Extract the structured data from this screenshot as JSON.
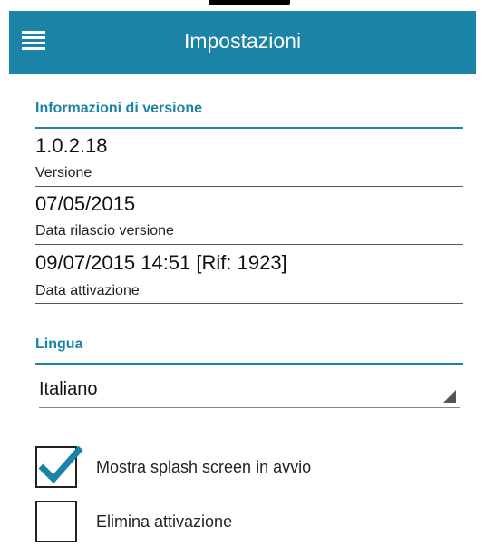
{
  "header": {
    "title": "Impostazioni",
    "menu_icon": "hamburger-menu-icon",
    "color": "#1b84a6"
  },
  "version_section": {
    "title": "Informazioni di versione",
    "items": [
      {
        "value": "1.0.2.18",
        "label": "Versione"
      },
      {
        "value": "07/05/2015",
        "label": "Data rilascio versione"
      },
      {
        "value": "09/07/2015 14:51 [Rif: 1923]",
        "label": "Data attivazione"
      }
    ]
  },
  "language_section": {
    "title": "Lingua",
    "selected": "Italiano"
  },
  "options": [
    {
      "label": "Mostra splash screen in avvio",
      "checked": true
    },
    {
      "label": "Elimina attivazione",
      "checked": false
    }
  ]
}
